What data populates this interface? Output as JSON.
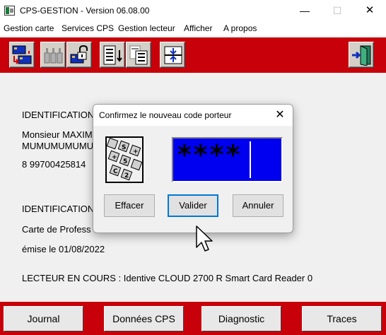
{
  "window": {
    "title": "CPS-GESTION - Version 06.08.00",
    "minimize_glyph": "—",
    "maximize_glyph": "☐",
    "close_glyph": "✕"
  },
  "menu": [
    "Gestion carte",
    "Services CPS",
    "Gestion lecteur",
    "Afficher",
    "A propos"
  ],
  "toolbar": {
    "buttons": [
      {
        "icon": "card-transfer-icon"
      },
      {
        "icon": "card-readers-icon"
      },
      {
        "icon": "card-unlock-icon"
      },
      {
        "icon": "document-list-icon"
      },
      {
        "icon": "documents-compare-icon"
      },
      {
        "icon": "split-arrows-icon"
      },
      {
        "icon": "exit-door-icon"
      }
    ]
  },
  "main": {
    "identification1": "IDENTIFICATION",
    "name_line1": "Monsieur MAXIM",
    "name_line2": "MUMUMUMUMU",
    "id_number": "8 99700425814",
    "identification2": "IDENTIFICATION",
    "card_type": "Carte de Profess",
    "issued": "émise le 01/08/2022",
    "reader": "LECTEUR EN COURS : Identive CLOUD 2700 R Smart Card Reader 0"
  },
  "dialog": {
    "title": "Confirmez le nouveau code porteur",
    "close_glyph": "✕",
    "pin_masked": "****",
    "buttons": {
      "clear": "Effacer",
      "validate": "Valider",
      "cancel": "Annuler"
    }
  },
  "bottom": {
    "journal": "Journal",
    "cps_data": "Données CPS",
    "diagnostic": "Diagnostic",
    "traces": "Traces"
  },
  "colors": {
    "toolbar_red": "#c8000a",
    "pin_blue": "#0000f0"
  }
}
